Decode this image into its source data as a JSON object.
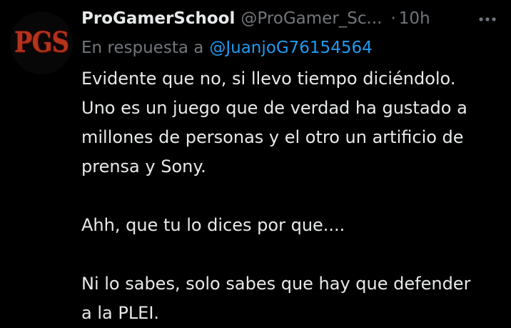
{
  "tweet": {
    "avatar_text": "PGS",
    "display_name": "ProGamerSchool",
    "handle": "@ProGamer_Sc...",
    "separator": "·",
    "time": "10h",
    "reply_prefix": "En respuesta a",
    "reply_mention": "@JuanjoG76154564",
    "paragraphs": [
      [
        "Evidente que no, si llevo tiempo diciéndolo.",
        "Uno es un juego que de verdad ha gustado a",
        "millones de personas y el otro un artificio de",
        "prensa y Sony."
      ],
      [
        "Ahh, que tu lo dices por que...."
      ],
      [
        "Ni lo sabes, solo sabes que hay que defender",
        "a la PLEI."
      ]
    ]
  },
  "icons": {
    "more": "more-horizontal-icon"
  },
  "colors": {
    "background": "#000000",
    "text": "#e7e9ea",
    "secondary": "#71767b",
    "link": "#1d9bf0",
    "avatar_logo": "#b5321c"
  }
}
